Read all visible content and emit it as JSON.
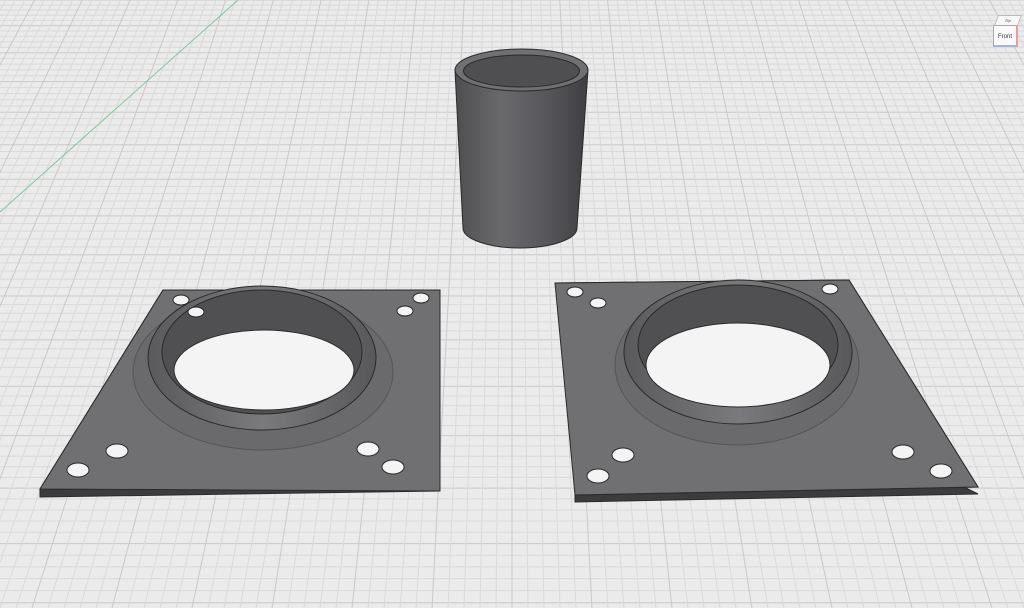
{
  "viewcube": {
    "top_label": "Top",
    "front_label": "Front"
  },
  "colors": {
    "background": "#ebebeb",
    "grid_minor": "#dadada",
    "grid_major": "#c9c9c9",
    "axis_green": "#7fc79a",
    "part_face": "#6e6e70",
    "part_dark": "#505053",
    "part_edge": "#2a2a2a",
    "hole_fill": "#f4f4f4"
  },
  "scene": {
    "objects": [
      "cylinder-tube",
      "flange-plate-left",
      "flange-plate-right"
    ]
  }
}
